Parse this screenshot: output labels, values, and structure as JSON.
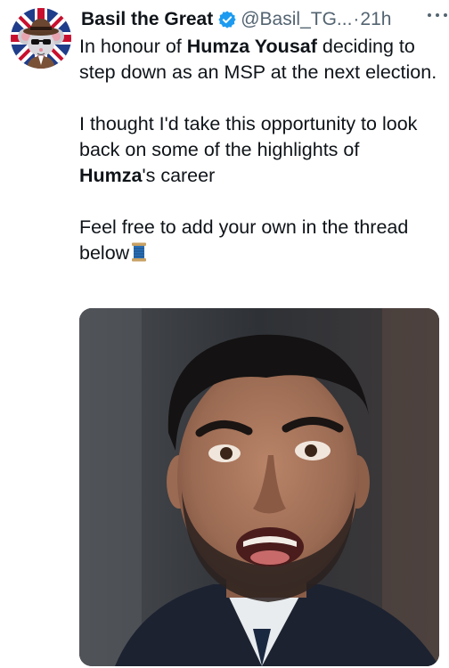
{
  "tweet": {
    "display_name": "Basil the Great",
    "handle": "@Basil_TG...",
    "separator": "·",
    "time": "21h",
    "verified": true,
    "avatar_icon": "mouse-in-fedora-union-jack-avatar",
    "more_icon": "more-horizontal-icon",
    "p1": {
      "a": "In honour of ",
      "b": "Humza Yousaf",
      "c": " deciding to step down as an MSP at the next election."
    },
    "p2": {
      "a": "I thought I'd take this opportunity to look back on some of the highlights of ",
      "b": "Humza",
      "c": "'s career"
    },
    "p3": {
      "a": "Feel free to add your own in the thread below",
      "emoji": "spool-of-thread-emoji"
    },
    "media_icon": "photo-of-man-speaking"
  },
  "colors": {
    "text": "#0f1419",
    "secondary": "#536471",
    "verified": "#1d9bf0"
  }
}
